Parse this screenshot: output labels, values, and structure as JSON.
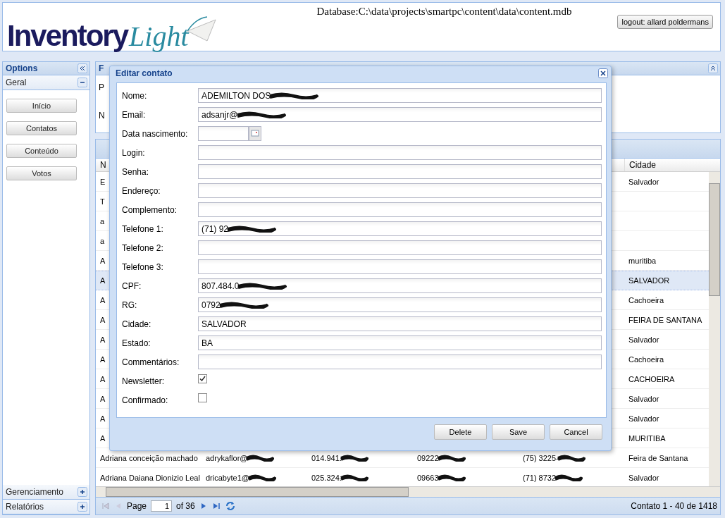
{
  "header": {
    "logo_main": "Inventory",
    "logo_script": "Light",
    "database": "Database:C:\\data\\projects\\smartpc\\content\\data\\content.mdb",
    "logout": "logout: allard poldermans"
  },
  "sidebar": {
    "title": "Options",
    "sections": [
      {
        "label": "Geral",
        "expanded": true,
        "buttons": [
          "Início",
          "Contatos",
          "Conteúdo",
          "Votos"
        ]
      },
      {
        "label": "Gerenciamento",
        "expanded": false
      },
      {
        "label": "Relatórios",
        "expanded": false
      }
    ]
  },
  "filter_panel": {
    "title": "F",
    "lines": [
      "P",
      "N"
    ]
  },
  "table": {
    "columns": [
      "N",
      "",
      "",
      "",
      "",
      "Cidade"
    ],
    "rows": [
      {
        "selected": false,
        "cells": [
          "E",
          "",
          "",
          "",
          "",
          "Salvador"
        ]
      },
      {
        "selected": false,
        "cells": [
          "T",
          "",
          "",
          "",
          "",
          ""
        ]
      },
      {
        "selected": false,
        "cells": [
          "a",
          "",
          "",
          "",
          "",
          ""
        ]
      },
      {
        "selected": false,
        "cells": [
          "a",
          "",
          "",
          "",
          "",
          ""
        ]
      },
      {
        "selected": false,
        "cells": [
          "A",
          "",
          "",
          "",
          "",
          "muritiba"
        ]
      },
      {
        "selected": true,
        "cells": [
          "A",
          "",
          "",
          "",
          "",
          "SALVADOR"
        ]
      },
      {
        "selected": false,
        "cells": [
          "A",
          "",
          "",
          "",
          "",
          "Cachoeira"
        ]
      },
      {
        "selected": false,
        "cells": [
          "A",
          "",
          "",
          "",
          "",
          "FEIRA DE SANTANA"
        ]
      },
      {
        "selected": false,
        "cells": [
          "A",
          "",
          "",
          "",
          "",
          "Salvador"
        ]
      },
      {
        "selected": false,
        "cells": [
          "A",
          "",
          "",
          "",
          "",
          "Cachoeira"
        ]
      },
      {
        "selected": false,
        "cells": [
          "A",
          "",
          "",
          "",
          "",
          "CACHOEIRA"
        ]
      },
      {
        "selected": false,
        "cells": [
          "A",
          "",
          "",
          "",
          "",
          "Salvador"
        ]
      },
      {
        "selected": false,
        "cells": [
          "A",
          "",
          "",
          "",
          "",
          "Salvador"
        ]
      },
      {
        "selected": false,
        "cells": [
          "A",
          "",
          "",
          "",
          "",
          "MURITIBA"
        ]
      },
      {
        "selected": false,
        "cells": [
          "Adriana conceição machado",
          {
            "text": "adrykaflor@",
            "redacted": true
          },
          {
            "text": "014.941.",
            "redacted": true
          },
          {
            "text": "09222",
            "redacted": true
          },
          {
            "text": "(75) 3225-",
            "redacted": true
          },
          "Feira de Santana"
        ]
      },
      {
        "selected": false,
        "cells": [
          "Adriana Daiana Dionizio Leal",
          {
            "text": "dricabyte1@",
            "redacted": true
          },
          {
            "text": "025.324.",
            "redacted": true
          },
          {
            "text": "09663",
            "redacted": true
          },
          {
            "text": "(71) 8732",
            "redacted": true
          },
          "Salvador"
        ]
      }
    ]
  },
  "pager": {
    "page_label": "Page",
    "page": "1",
    "of": "of 36",
    "summary": "Contato 1 - 40 de 1418"
  },
  "dialog": {
    "title": "Editar contato",
    "fields": [
      {
        "kind": "text",
        "label": "Nome:",
        "value": "ADEMILTON DOS",
        "redacted": true
      },
      {
        "kind": "text",
        "label": "Email:",
        "value": "adsanjr@",
        "redacted": true
      },
      {
        "kind": "date",
        "label": "Data nascimento:"
      },
      {
        "kind": "text",
        "label": "Login:"
      },
      {
        "kind": "text",
        "label": "Senha:"
      },
      {
        "kind": "text",
        "label": "Endereço:"
      },
      {
        "kind": "text",
        "label": "Complemento:"
      },
      {
        "kind": "text",
        "label": "Telefone 1:",
        "value": "(71) 92",
        "redacted": true
      },
      {
        "kind": "text",
        "label": "Telefone 2:"
      },
      {
        "kind": "text",
        "label": "Telefone 3:"
      },
      {
        "kind": "text",
        "label": "CPF:",
        "value": "807.484.0",
        "redacted": true
      },
      {
        "kind": "text",
        "label": "RG:",
        "value": "0792",
        "redacted": true
      },
      {
        "kind": "text",
        "label": "Cidade:",
        "value": "SALVADOR"
      },
      {
        "kind": "text",
        "label": "Estado:",
        "value": "BA"
      },
      {
        "kind": "text",
        "label": "Commentários:"
      },
      {
        "kind": "checkbox",
        "label": "Newsletter:",
        "checked": true
      },
      {
        "kind": "checkbox",
        "label": "Confirmado:",
        "checked": false
      }
    ],
    "buttons": [
      "Delete",
      "Save",
      "Cancel"
    ]
  }
}
